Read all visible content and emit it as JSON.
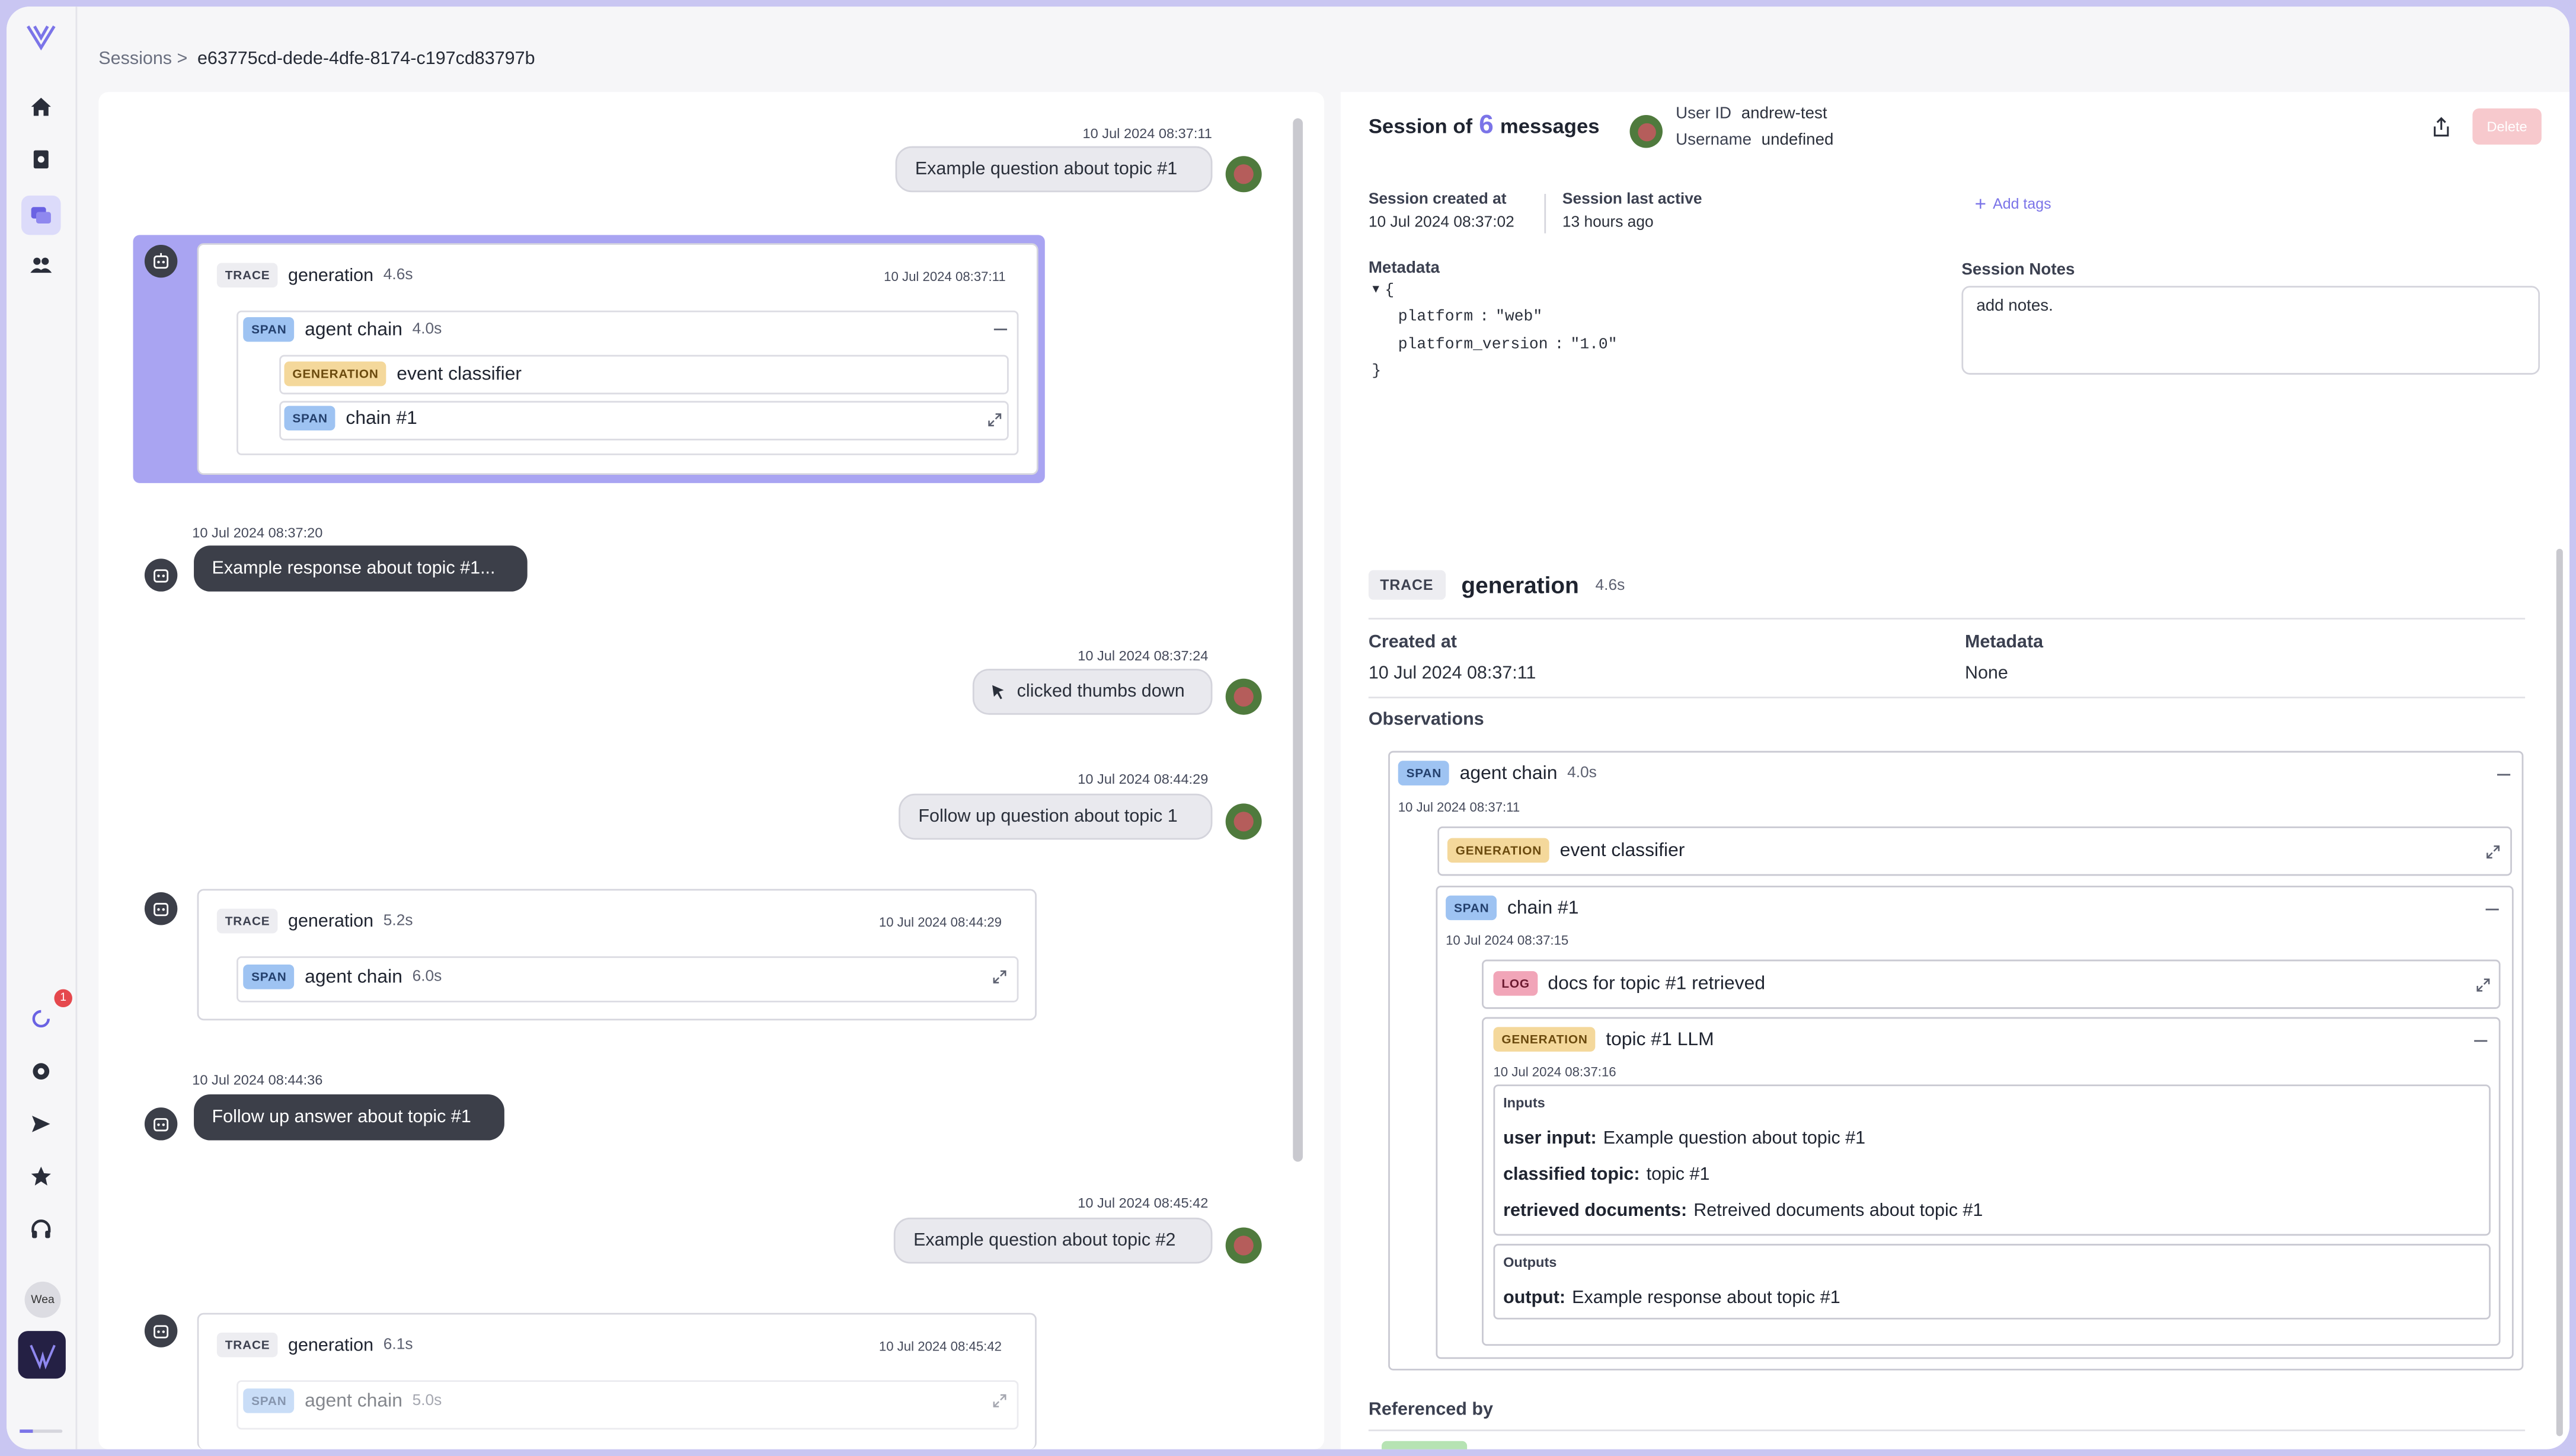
{
  "breadcrumb": {
    "parent": "Sessions >",
    "session_id": "e63775cd-dede-4dfe-8174-c197cd83797b"
  },
  "sidebar": {
    "items": [
      "home-icon",
      "document-icon",
      "chat-icon",
      "users-icon"
    ],
    "bottom_items": [
      "refresh-icon",
      "settings-icon",
      "send-icon",
      "star-icon",
      "headphones-icon"
    ],
    "notification_count": "1",
    "avatar_text": "Wea"
  },
  "chat": {
    "messages": [
      {
        "role": "user",
        "ts": "10 Jul 2024 08:37:11",
        "text": "Example question about topic #1"
      },
      {
        "role": "trace",
        "ts": "10 Jul 2024 08:37:11",
        "trace": "TRACE",
        "name": "generation",
        "dur": "4.6s",
        "span": {
          "tag": "SPAN",
          "name": "agent chain",
          "dur": "4.0s"
        },
        "children": [
          {
            "tag": "GENERATION",
            "name": "event classifier"
          },
          {
            "tag": "SPAN",
            "name": "chain #1"
          }
        ]
      },
      {
        "role": "assistant",
        "ts": "10 Jul 2024 08:37:20",
        "text": "Example response about topic #1..."
      },
      {
        "role": "user",
        "ts": "10 Jul 2024 08:37:24",
        "text": "clicked thumbs down"
      },
      {
        "role": "user",
        "ts": "10 Jul 2024 08:44:29",
        "text": "Follow up question about topic 1"
      },
      {
        "role": "trace",
        "ts": "10 Jul 2024 08:44:29",
        "trace": "TRACE",
        "name": "generation",
        "dur": "5.2s",
        "span": {
          "tag": "SPAN",
          "name": "agent chain",
          "dur": "6.0s"
        }
      },
      {
        "role": "assistant",
        "ts": "10 Jul 2024 08:44:36",
        "text": "Follow up answer about topic #1"
      },
      {
        "role": "user",
        "ts": "10 Jul 2024 08:45:42",
        "text": "Example question about topic #2"
      },
      {
        "role": "trace",
        "ts": "10 Jul 2024 08:45:42",
        "trace": "TRACE",
        "name": "generation",
        "dur": "6.1s",
        "span": {
          "tag": "SPAN",
          "name": "agent chain",
          "dur": "5.0s"
        }
      }
    ]
  },
  "session": {
    "title_prefix": "Session of",
    "count": "6",
    "title_suffix": "messages",
    "user_id_label": "User ID",
    "user_id": "andrew-test",
    "username_label": "Username",
    "username": "undefined",
    "delete_label": "Delete",
    "created_label": "Session created at",
    "created": "10 Jul 2024 08:37:02",
    "last_active_label": "Session last active",
    "last_active": "13 hours ago",
    "add_tags": "Add tags",
    "metadata_label": "Metadata",
    "metadata_open": "{",
    "metadata_lines": [
      {
        "k": "platform",
        "v": "\"web\""
      },
      {
        "k": "platform_version",
        "v": "\"1.0\""
      }
    ],
    "metadata_close": "}",
    "notes_label": "Session Notes",
    "notes": "add notes."
  },
  "detail": {
    "tag": "TRACE",
    "name": "generation",
    "dur": "4.6s",
    "created_label": "Created at",
    "created": "10 Jul 2024 08:37:11",
    "metadata_label": "Metadata",
    "metadata": "None",
    "observations_label": "Observations",
    "span": {
      "tag": "SPAN",
      "name": "agent chain",
      "dur": "4.0s",
      "ts": "10 Jul 2024 08:37:11"
    },
    "classifier": {
      "tag": "GENERATION",
      "name": "event classifier"
    },
    "chain": {
      "tag": "SPAN",
      "name": "chain #1",
      "ts": "10 Jul 2024 08:37:15"
    },
    "log": {
      "tag": "LOG",
      "name": "docs for topic #1 retrieved"
    },
    "llm": {
      "tag": "GENERATION",
      "name": "topic #1 LLM",
      "ts": "10 Jul 2024 08:37:16"
    },
    "inputs_label": "Inputs",
    "inputs": [
      {
        "k": "user input:",
        "v": "Example question about topic #1"
      },
      {
        "k": "classified topic:",
        "v": "topic #1"
      },
      {
        "k": "retrieved documents:",
        "v": "Retreived documents about topic #1"
      }
    ],
    "outputs_label": "Outputs",
    "outputs": [
      {
        "k": "output:",
        "v": "Example response about topic #1"
      }
    ],
    "referenced_by": "Referenced by"
  },
  "colors": {
    "accent": "#7b74e8",
    "selected_bg": "#a9a4f2",
    "delete_bg": "#f7c9cd"
  }
}
